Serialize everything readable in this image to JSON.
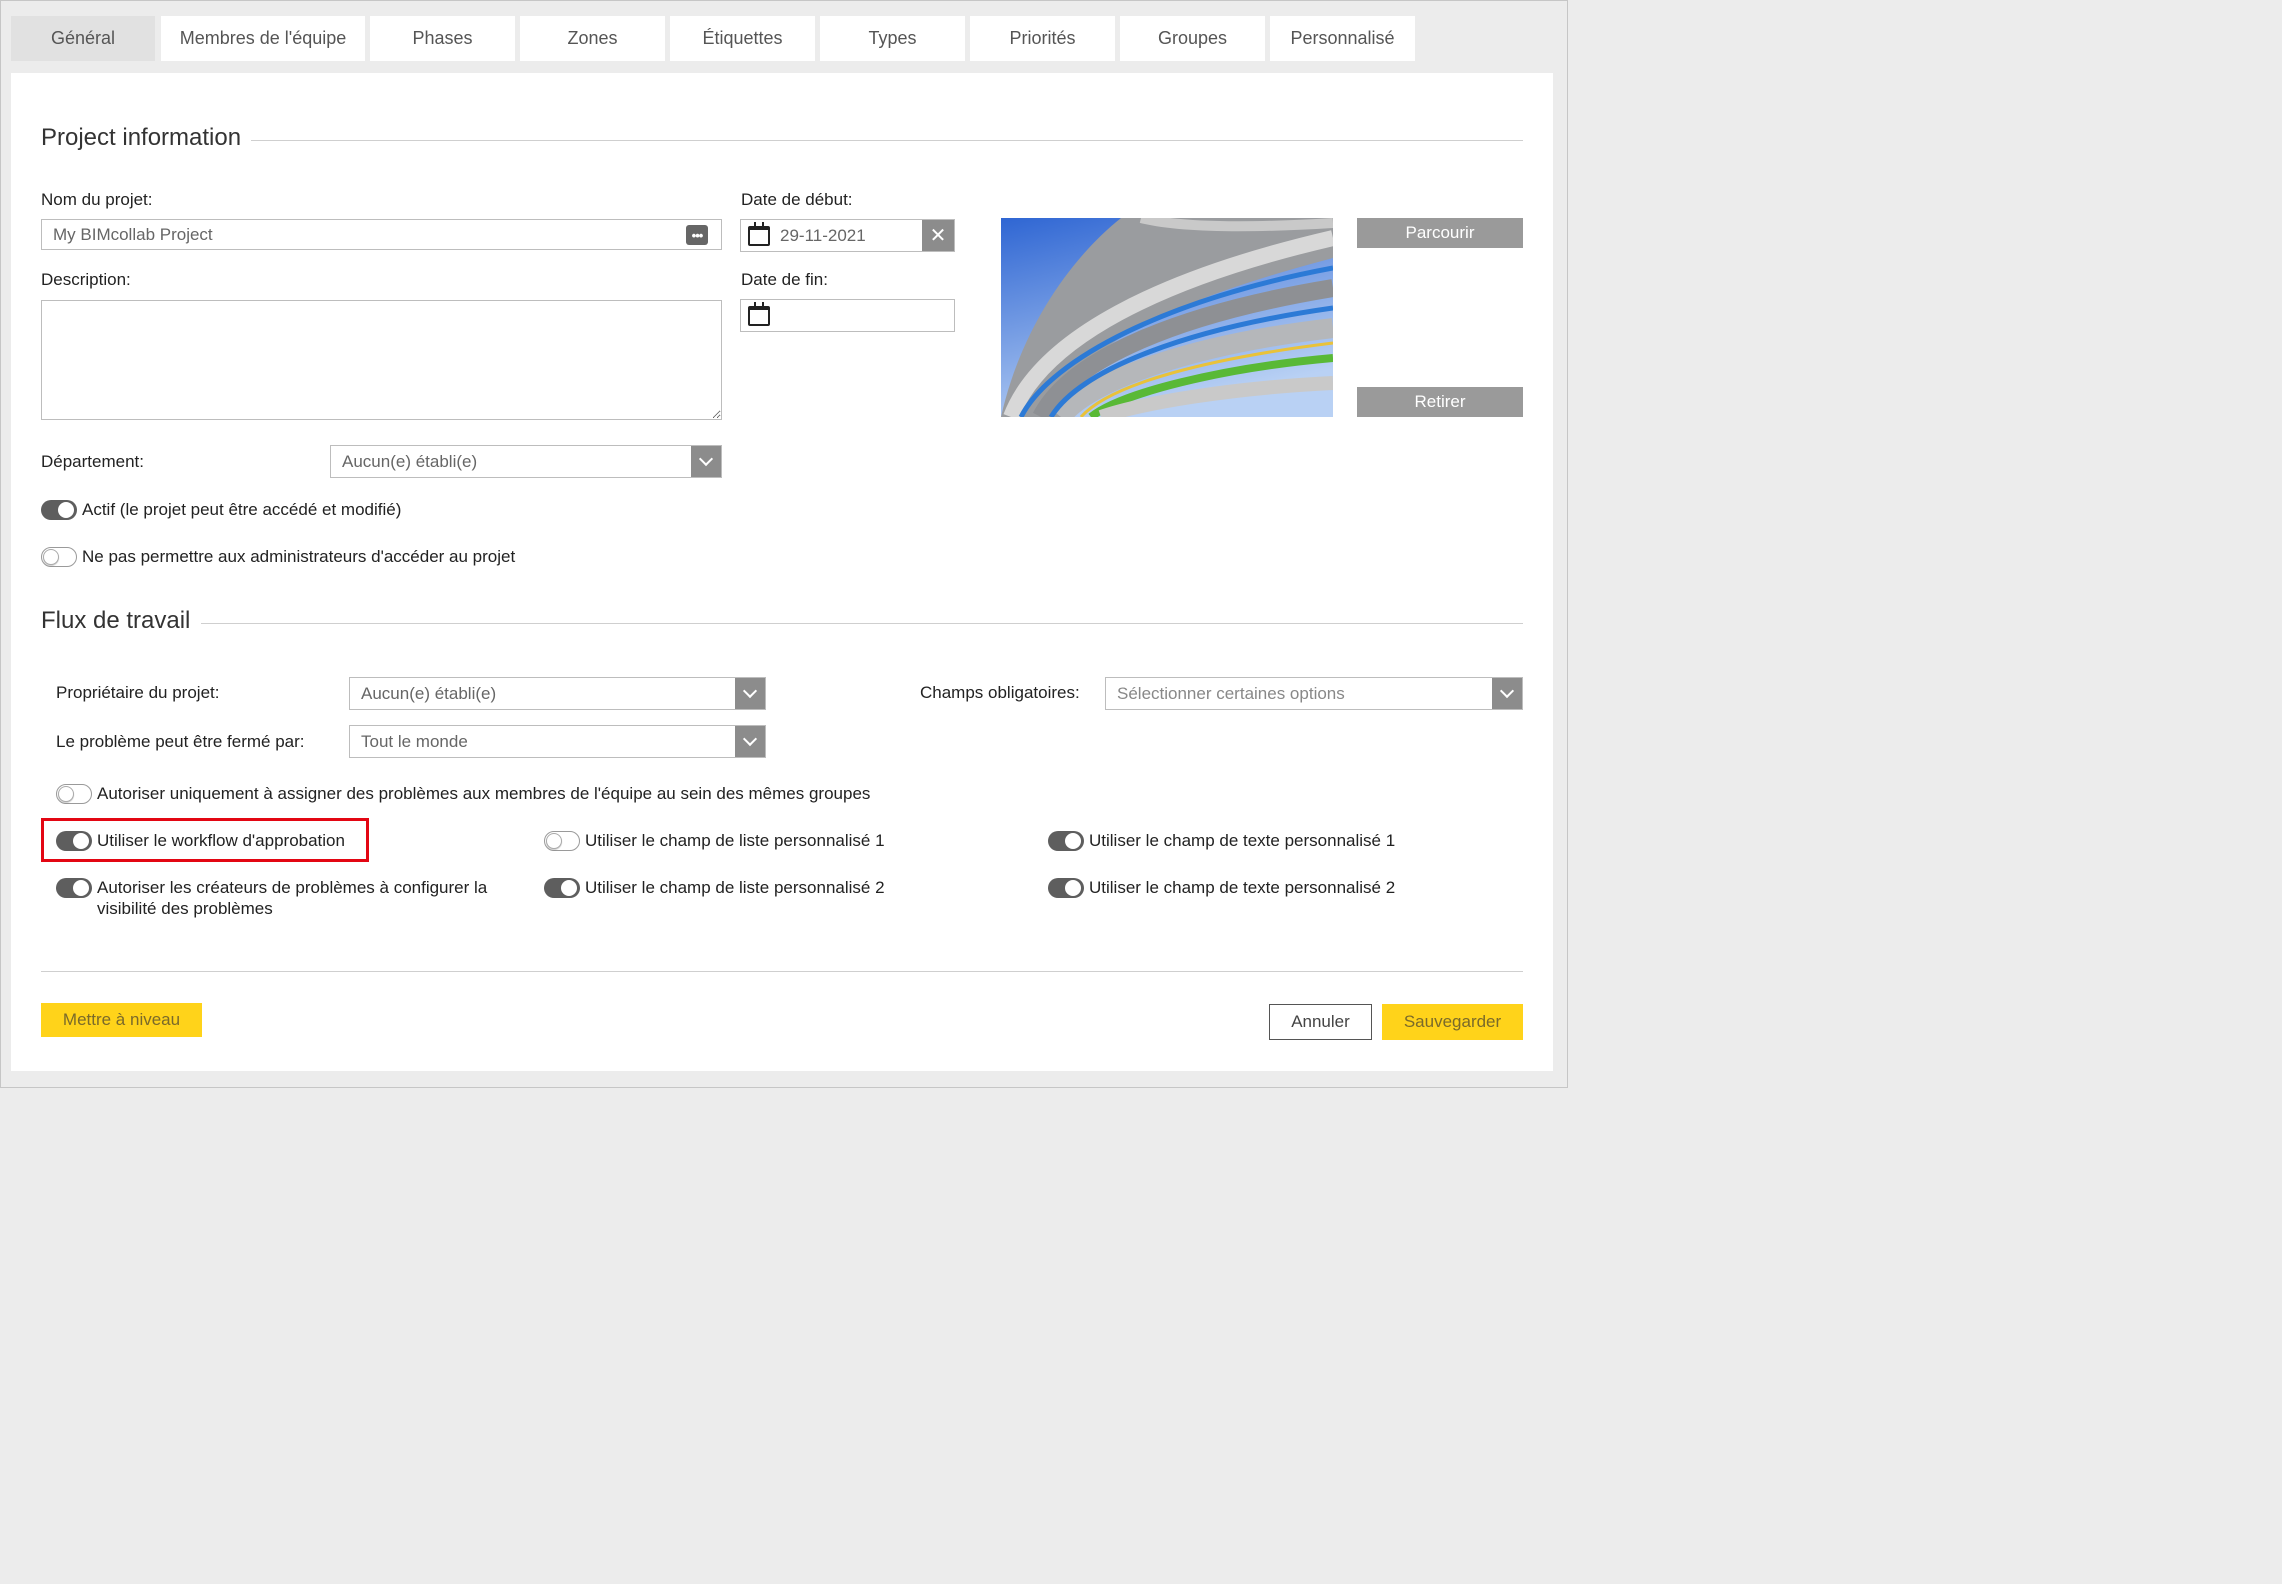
{
  "tabs": [
    {
      "label": "Général",
      "active": true
    },
    {
      "label": "Membres de l'équipe"
    },
    {
      "label": "Phases"
    },
    {
      "label": "Zones"
    },
    {
      "label": "Étiquettes"
    },
    {
      "label": "Types"
    },
    {
      "label": "Priorités"
    },
    {
      "label": "Groupes"
    },
    {
      "label": "Personnalisé"
    }
  ],
  "project_info": {
    "title": "Project information",
    "name_label": "Nom du projet:",
    "name_value": "My BIMcollab Project",
    "description_label": "Description:",
    "description_value": "",
    "start_date_label": "Date de début:",
    "start_date_value": "29-11-2021",
    "end_date_label": "Date de fin:",
    "end_date_value": "",
    "department_label": "Département:",
    "department_value": "Aucun(e) établi(e)",
    "browse_button": "Parcourir",
    "remove_button": "Retirer",
    "active_toggle": {
      "label": "Actif (le projet peut être accédé et modifié)",
      "on": true
    },
    "no_admin_toggle": {
      "label": "Ne pas permettre aux administrateurs d'accéder au projet",
      "on": false
    }
  },
  "workflow": {
    "title": "Flux de travail",
    "owner_label": "Propriétaire du projet:",
    "owner_value": "Aucun(e) établi(e)",
    "closed_by_label": "Le problème peut être fermé par:",
    "closed_by_value": "Tout le monde",
    "mandatory_label": "Champs obligatoires:",
    "mandatory_placeholder": "Sélectionner certaines options",
    "toggles": {
      "assign_groups": {
        "label": "Autoriser uniquement à assigner des problèmes aux membres de l'équipe au sein des mêmes groupes",
        "on": false
      },
      "approval": {
        "label": "Utiliser le workflow d'approbation",
        "on": true,
        "highlighted": true
      },
      "visibility": {
        "label": "Autoriser les créateurs de problèmes à configurer la visibilité des problèmes",
        "on": true
      },
      "list1": {
        "label": "Utiliser le champ de liste personnalisé 1",
        "on": false
      },
      "list2": {
        "label": "Utiliser le champ de liste personnalisé 2",
        "on": true
      },
      "text1": {
        "label": "Utiliser le champ de texte personnalisé 1",
        "on": true
      },
      "text2": {
        "label": "Utiliser le champ de texte personnalisé 2",
        "on": true
      }
    }
  },
  "footer": {
    "upgrade_button": "Mettre à niveau",
    "cancel_button": "Annuler",
    "save_button": "Sauvegarder"
  },
  "colors": {
    "accent_yellow": "#ffd31a",
    "highlight_red": "#e30613",
    "toggle_on": "#5e5e5e"
  }
}
